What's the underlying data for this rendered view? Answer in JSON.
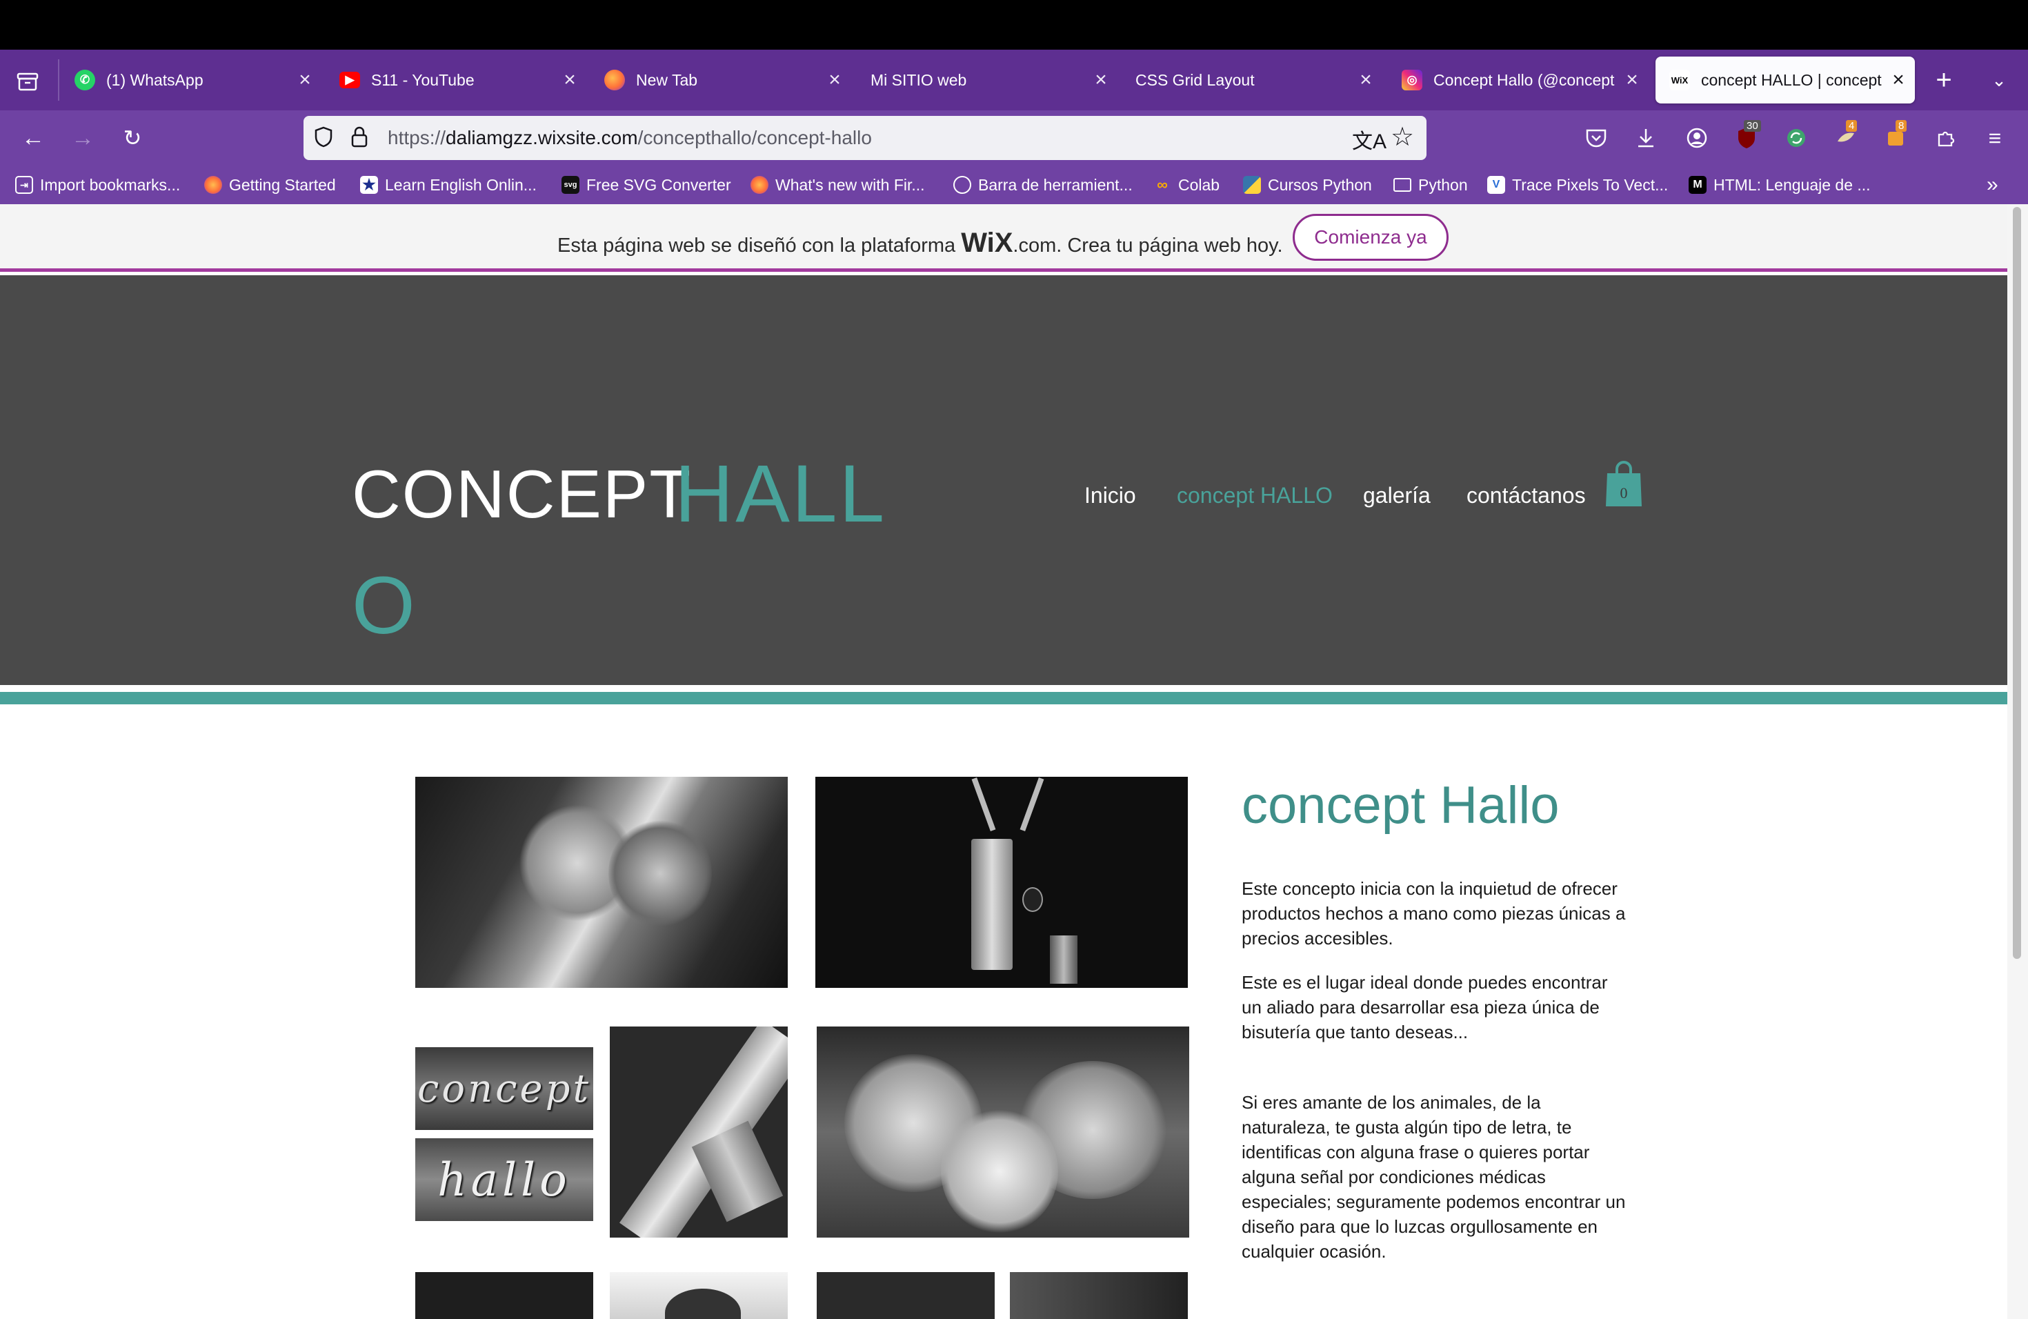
{
  "tabs": [
    {
      "title": "(1) WhatsApp",
      "icon": "whatsapp-icon",
      "color": "#25d366"
    },
    {
      "title": "S11 - YouTube",
      "icon": "youtube-icon",
      "color": "#ff0000"
    },
    {
      "title": "New Tab",
      "icon": "firefox-icon",
      "color": "#ff7139"
    },
    {
      "title": "Mi SITIO web",
      "icon": "blank-page-icon",
      "color": ""
    },
    {
      "title": "CSS Grid Layout",
      "icon": "blank-page-icon",
      "color": ""
    },
    {
      "title": "Concept Hallo (@concept",
      "icon": "instagram-icon",
      "color": "#d6249f"
    },
    {
      "title": "concept HALLO | concept",
      "icon": "wix-icon",
      "color": "#000000",
      "active": true
    }
  ],
  "toolbar": {
    "url_scheme": "https://",
    "url_domain": "daliamgzz.wixsite.com",
    "url_path": "/concepthallo/concept-hallo",
    "badge_shield": "30",
    "badge_ext1": "4",
    "badge_ext2": "8"
  },
  "bookmarks": [
    {
      "label": "Import bookmarks...",
      "icon": "import-icon"
    },
    {
      "label": "Getting Started",
      "icon": "firefox-icon"
    },
    {
      "label": "Learn English Onlin...",
      "icon": "star-icon"
    },
    {
      "label": "Free SVG Converter",
      "icon": "svg-icon"
    },
    {
      "label": "What's new with Fir...",
      "icon": "firefox-icon"
    },
    {
      "label": "Barra de herramient...",
      "icon": "globe-icon"
    },
    {
      "label": "Colab",
      "icon": "colab-icon"
    },
    {
      "label": "Cursos Python",
      "icon": "python-icon"
    },
    {
      "label": "Python",
      "icon": "folder-icon"
    },
    {
      "label": "Trace Pixels To Vect...",
      "icon": "trace-icon"
    },
    {
      "label": "HTML: Lenguaje de ...",
      "icon": "mdn-icon"
    }
  ],
  "wix_banner": {
    "text_before": "Esta página web se diseñó con la plataforma",
    "brand": "WiX",
    "text_after": ".com. Crea tu página web hoy.",
    "button": "Comienza ya"
  },
  "site": {
    "logo_part1": "CONCEPT",
    "logo_part2": "HALL",
    "logo_part3": "O",
    "nav": [
      "Inicio",
      "concept HALLO",
      "galería",
      "contáctanos"
    ],
    "cart_count": "0",
    "accent": "#49a29a"
  },
  "content": {
    "title": "concept Hallo",
    "p1": "Este concepto inicia con la inquietud de ofrecer productos hechos a mano como piezas únicas a precios accesibles.",
    "p2": "Este es el lugar ideal donde puedes encontrar un aliado para desarrollar esa pieza única de bisutería que tanto deseas...",
    "p3": "Si eres amante de los animales, de la naturaleza, te gusta algún tipo de letra, te identificas con alguna frase o quieres portar alguna señal por condiciones médicas especiales; seguramente podemos encontrar un diseño para que lo luzcas orgullosamente en cualquier ocasión.",
    "engraving_top": "concept",
    "engraving_bottom": "hallo"
  }
}
